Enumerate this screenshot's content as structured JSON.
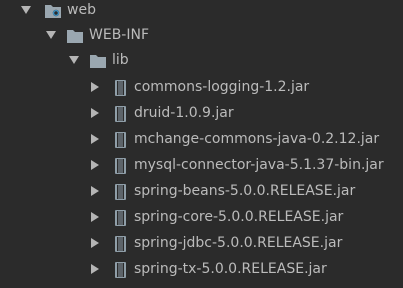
{
  "tree": {
    "root": {
      "label": "web",
      "expanded": true,
      "icon": "web-module-folder-icon"
    },
    "webinf": {
      "label": "WEB-INF",
      "expanded": true,
      "icon": "folder-icon"
    },
    "lib": {
      "label": "lib",
      "expanded": true,
      "icon": "folder-icon"
    },
    "jars": [
      {
        "label": "commons-logging-1.2.jar",
        "icon": "jar-icon"
      },
      {
        "label": "druid-1.0.9.jar",
        "icon": "jar-icon"
      },
      {
        "label": "mchange-commons-java-0.2.12.jar",
        "icon": "jar-icon"
      },
      {
        "label": "mysql-connector-java-5.1.37-bin.jar",
        "icon": "jar-icon"
      },
      {
        "label": "spring-beans-5.0.0.RELEASE.jar",
        "icon": "jar-icon"
      },
      {
        "label": "spring-core-5.0.0.RELEASE.jar",
        "icon": "jar-icon"
      },
      {
        "label": "spring-jdbc-5.0.0.RELEASE.jar",
        "icon": "jar-icon"
      },
      {
        "label": "spring-tx-5.0.0.RELEASE.jar",
        "icon": "jar-icon"
      }
    ]
  },
  "colors": {
    "background": "#2b2b2b",
    "text": "#bbbbbb",
    "arrow": "#b5b5b5",
    "folder": "#9aa7b0",
    "web_accent": "#3d9ad1",
    "jar": "#8f9ea8"
  }
}
